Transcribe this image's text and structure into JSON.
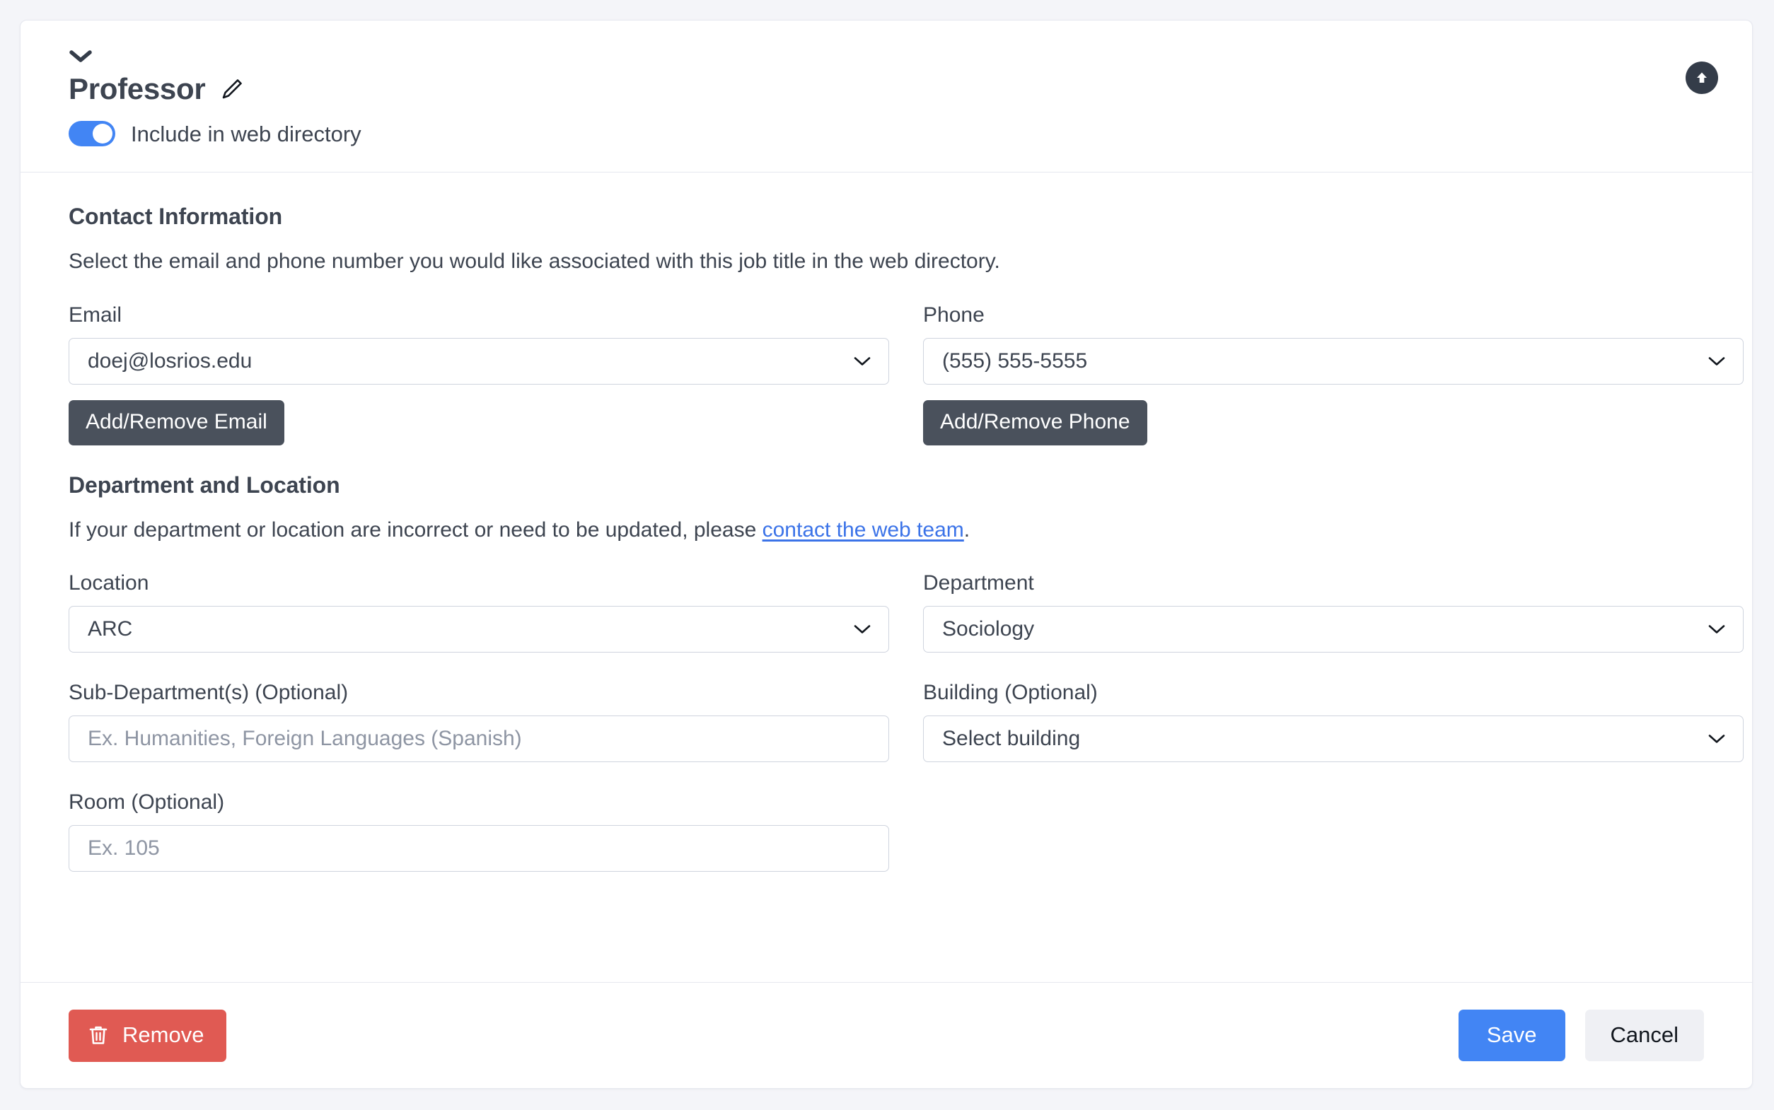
{
  "header": {
    "collapse_icon": "chevron-down-icon",
    "job_title": "Professor",
    "edit_icon": "pencil-icon",
    "directory_toggle_label": "Include in web directory",
    "directory_toggle_on": true,
    "scroll_top_icon": "arrow-up-circle-icon",
    "toggle_color": "#4285f4"
  },
  "contact": {
    "heading": "Contact Information",
    "description": "Select the email and phone number you would like associated with this job title in the web directory.",
    "email": {
      "label": "Email",
      "value": "doej@losrios.edu",
      "button_label": "Add/Remove Email"
    },
    "phone": {
      "label": "Phone",
      "value": "(555) 555-5555",
      "button_label": "Add/Remove Phone"
    }
  },
  "department": {
    "heading": "Department and Location",
    "description_before": "If your department or location are incorrect or need to be updated, please ",
    "description_link": "contact the web team",
    "description_after": ".",
    "location": {
      "label": "Location",
      "value": "ARC"
    },
    "dept": {
      "label": "Department",
      "value": "Sociology"
    },
    "subdept": {
      "label": "Sub-Department(s) (Optional)",
      "value": "",
      "placeholder": "Ex. Humanities, Foreign Languages (Spanish)"
    },
    "building": {
      "label": "Building (Optional)",
      "value": "Select building"
    },
    "room": {
      "label": "Room (Optional)",
      "value": "",
      "placeholder": "Ex. 105"
    }
  },
  "footer": {
    "remove_label": "Remove",
    "remove_icon": "trash-icon",
    "remove_color": "#e05a53",
    "save_label": "Save",
    "save_color": "#4285f4",
    "cancel_label": "Cancel"
  }
}
